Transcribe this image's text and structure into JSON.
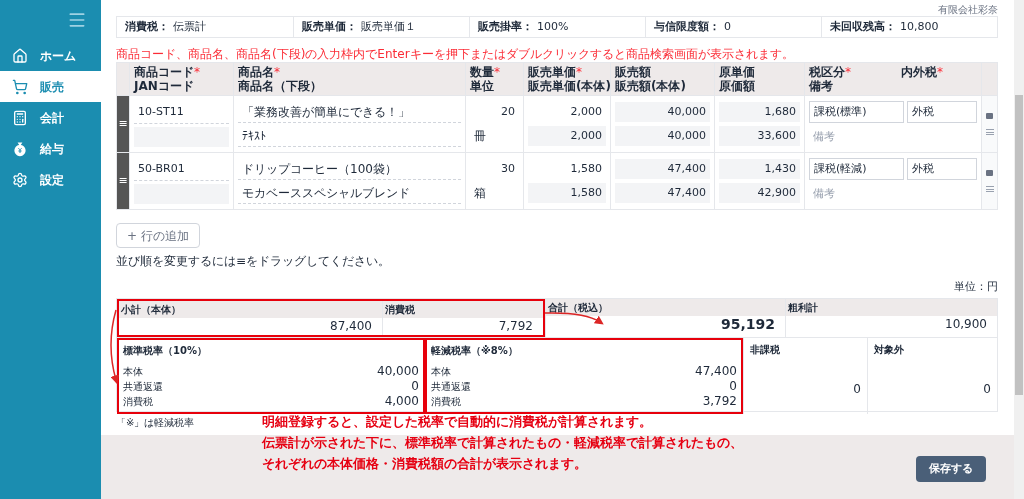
{
  "sidebar": {
    "items": [
      {
        "label": "ホーム",
        "selected": false
      },
      {
        "label": "販売",
        "selected": true
      },
      {
        "label": "会計",
        "selected": false
      },
      {
        "label": "給与",
        "selected": false
      },
      {
        "label": "設定",
        "selected": false
      }
    ]
  },
  "company": "有限会社彩奈",
  "required_mark": "*",
  "drag_handle": "≡",
  "info_bar": [
    {
      "label": "消費税：",
      "value": "伝票計"
    },
    {
      "label": "販売単価：",
      "value": "販売単価１"
    },
    {
      "label": "販売掛率：",
      "value": "100%"
    },
    {
      "label": "与信限度額：",
      "value": "0"
    },
    {
      "label": "未回収残高：",
      "value": "10,800"
    }
  ],
  "notice": "商品コード、商品名、商品名(下段)の入力枠内でEnterキーを押下またはダブルクリックすると商品検索画面が表示されます。",
  "table": {
    "columns": [
      {
        "line1": [
          {
            "text": "商品コード",
            "required": true
          }
        ],
        "line2": "JANコード"
      },
      {
        "line1": [
          {
            "text": "商品名",
            "required": true
          }
        ],
        "line2": "商品名（下段）"
      },
      {
        "line1": [
          {
            "text": "数量",
            "required": true
          }
        ],
        "line2": "単位"
      },
      {
        "line1": [
          {
            "text": "販売単価",
            "required": true
          }
        ],
        "line2": "販売単価(本体)"
      },
      {
        "line1": [
          {
            "text": "販売額",
            "required": false
          }
        ],
        "line2": "販売額(本体)"
      },
      {
        "line1": [
          {
            "text": "原単価",
            "required": false
          }
        ],
        "line2": "原価額"
      },
      {
        "line1": [
          {
            "text": "税区分",
            "required": true
          },
          {
            "text": "内外税",
            "required": true
          }
        ],
        "line2": "備考"
      }
    ],
    "rows": [
      {
        "code": "10-ST11",
        "name": "「業務改善が簡単にできる！」",
        "name2": "ﾃｷｽﾄ",
        "qty": "20",
        "unit": "冊",
        "price": "2,000",
        "price_net": "2,000",
        "amount": "40,000",
        "amount_net": "40,000",
        "cost": "1,680",
        "cost_total": "33,600",
        "tax_class": "課税(標準)",
        "tax_mode": "外税",
        "note_placeholder": "備考"
      },
      {
        "code": "50-BR01",
        "name": "ドリップコーヒー（100袋）",
        "name2": "モカベーススペシャルブレンド",
        "qty": "30",
        "unit": "箱",
        "price": "1,580",
        "price_net": "1,580",
        "amount": "47,400",
        "amount_net": "47,400",
        "cost": "1,430",
        "cost_total": "42,900",
        "tax_class": "課税(軽減)",
        "tax_mode": "外税",
        "note_placeholder": "備考"
      }
    ]
  },
  "add_row_button": "+ 行の追加",
  "drag_hint": "並び順を変更するには≡をドラッグしてください。",
  "unit_label": "単位：円",
  "summary": [
    {
      "label": "小計（本体）",
      "value": "87,400",
      "emphasized": false
    },
    {
      "label": "消費税",
      "value": "7,792",
      "emphasized": false
    },
    {
      "label": "合計（税込）",
      "value": "95,192",
      "emphasized": true
    },
    {
      "label": "粗利計",
      "value": "10,900",
      "emphasized": false
    }
  ],
  "breakdown": [
    {
      "title": "標準税率（10%）",
      "lines": [
        {
          "label": "本体",
          "value": "40,000"
        },
        {
          "label": "共通返還",
          "value": "0"
        },
        {
          "label": "消費税",
          "value": "4,000"
        }
      ]
    },
    {
      "title": "軽減税率（※8%）",
      "lines": [
        {
          "label": "本体",
          "value": "47,400"
        },
        {
          "label": "共通返還",
          "value": "0"
        },
        {
          "label": "消費税",
          "value": "3,792"
        }
      ]
    }
  ],
  "other_totals": [
    {
      "title": "非課税",
      "value": "0"
    },
    {
      "title": "対象外",
      "value": "0"
    }
  ],
  "footnote": "「※」は軽減税率",
  "annotation": [
    "明細登録すると、設定した税率で自動的に消費税が計算されます。",
    "伝票計が示された下に、標準税率で計算されたもの・軽減税率で計算されたもの、",
    "それぞれの本体価格・消費税額の合計が表示されます。"
  ],
  "save_button": "保存する"
}
